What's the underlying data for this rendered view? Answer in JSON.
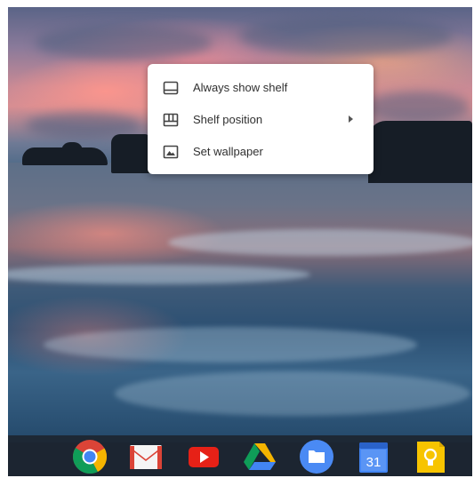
{
  "desktop": {
    "wallpaper": "sunset-seascape"
  },
  "context_menu": {
    "items": [
      {
        "label": "Always show shelf",
        "icon": "shelf-icon"
      },
      {
        "label": "Shelf position",
        "icon": "shelf-position-icon",
        "has_submenu": true
      },
      {
        "label": "Set wallpaper",
        "icon": "wallpaper-icon"
      }
    ]
  },
  "shelf": {
    "apps": [
      {
        "name": "Chrome",
        "icon": "chrome-icon"
      },
      {
        "name": "Gmail",
        "icon": "gmail-icon"
      },
      {
        "name": "YouTube",
        "icon": "youtube-icon"
      },
      {
        "name": "Google Drive",
        "icon": "drive-icon"
      },
      {
        "name": "Files",
        "icon": "files-icon"
      },
      {
        "name": "Calendar",
        "icon": "calendar-icon",
        "badge": "31"
      },
      {
        "name": "Keep",
        "icon": "keep-icon"
      }
    ]
  },
  "colors": {
    "chrome_red": "#db4437",
    "chrome_yellow": "#f4b400",
    "chrome_green": "#0f9d58",
    "chrome_blue": "#4285f4",
    "youtube_red": "#e62117",
    "files_blue": "#4a8af4",
    "keep_yellow": "#f7c400"
  }
}
